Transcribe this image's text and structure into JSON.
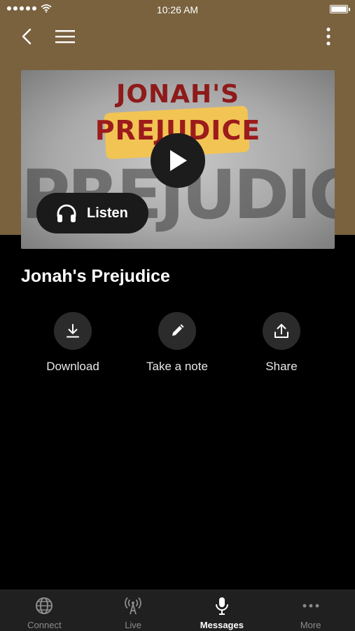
{
  "status_bar": {
    "time": "10:26 AM"
  },
  "thumbnail": {
    "line1": "JONAH'S",
    "line2": "PREJUDICE",
    "big_word": "PREJUDICES"
  },
  "listen": {
    "label": "Listen"
  },
  "message": {
    "title": "Jonah's Prejudice"
  },
  "actions": [
    {
      "label": "Download",
      "icon": "download-icon"
    },
    {
      "label": "Take a note",
      "icon": "pencil-icon"
    },
    {
      "label": "Share",
      "icon": "share-icon"
    }
  ],
  "tabs": [
    {
      "label": "Connect",
      "icon": "globe-icon",
      "active": false
    },
    {
      "label": "Live",
      "icon": "broadcast-icon",
      "active": false
    },
    {
      "label": "Messages",
      "icon": "microphone-icon",
      "active": true
    },
    {
      "label": "More",
      "icon": "more-icon",
      "active": false
    }
  ],
  "colors": {
    "header_background": "#7a623f",
    "page_background": "#000000",
    "tab_bar": "#202020"
  }
}
